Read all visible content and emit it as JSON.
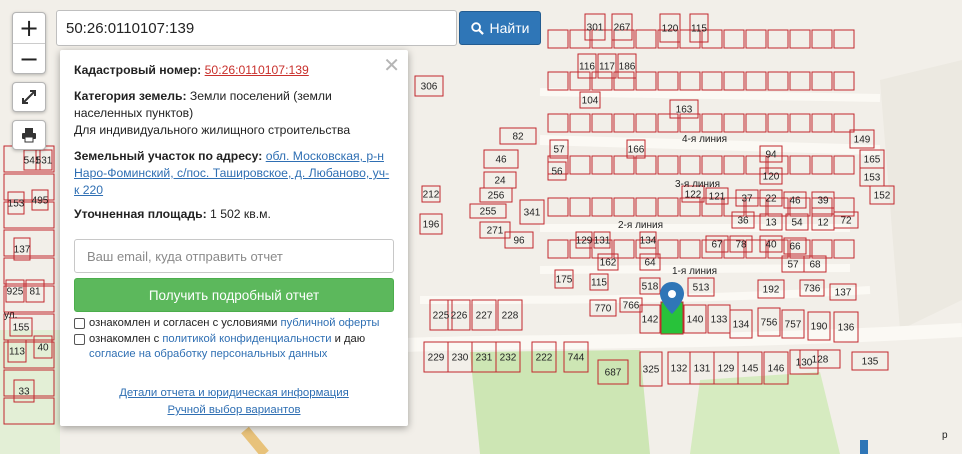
{
  "search": {
    "value": "50:26:0110107:139",
    "button_label": "Найти"
  },
  "zoom": {
    "in_label": "+",
    "out_label": "−"
  },
  "tools": {
    "fullscreen_icon": "fullscreen-icon",
    "print_icon": "printer-icon"
  },
  "popup": {
    "cadastral_label": "Кадастровый номер:",
    "cadastral_value": "50:26:0110107:139",
    "category_label": "Категория земель:",
    "category_value": "Земли поселений (земли населенных пунктов)",
    "usage": "Для индивидуального жилищного строительства",
    "address_label": "Земельный участок по адресу:",
    "address_value": "обл. Московская, р-н Наро-Фоминский, с/пос. Ташировское, д. Любаново, уч-к 220",
    "area_label": "Уточненная площадь:",
    "area_value": "1 502 кв.м.",
    "email_placeholder": "Ваш email, куда отправить отчет",
    "report_button": "Получить подробный отчет",
    "consent1_text": "ознакомлен и согласен с условиями ",
    "consent1_link": "публичной оферты",
    "consent2_text": "ознакомлен с ",
    "consent2_link": "политикой конфиденциальности",
    "consent2_tail": " и даю",
    "consent2_link2": "согласие на обработку персональных данных",
    "details_link": "Детали отчета и юридическая информация",
    "manual_link": "Ручной выбор вариантов"
  },
  "map": {
    "colors": {
      "parcel": "#c2272d",
      "selected": "#28c23a",
      "road": "#f7f4ee",
      "green": "#cde6b4",
      "marker": "#2f76b7"
    },
    "street_labels": [
      "4-я линия",
      "3-я линия",
      "2-я линия",
      "1-я линия",
      "ул.",
      "р"
    ],
    "parcel_numbers": [
      "301",
      "267",
      "120",
      "115",
      "116",
      "117",
      "186",
      "306",
      "104",
      "163",
      "82",
      "57",
      "166",
      "56",
      "46",
      "24",
      "256",
      "255",
      "271",
      "96",
      "341",
      "212",
      "196",
      "129",
      "131",
      "134",
      "162",
      "64",
      "175",
      "115",
      "518",
      "770",
      "766",
      "142",
      "140",
      "133",
      "134",
      "756",
      "757",
      "190",
      "136",
      "513",
      "192",
      "736",
      "137",
      "228",
      "227",
      "225",
      "226",
      "229",
      "230",
      "231",
      "232",
      "222",
      "744",
      "687",
      "325",
      "132",
      "131",
      "129",
      "145",
      "146",
      "130",
      "128",
      "135",
      "122",
      "121",
      "37",
      "22",
      "46",
      "39",
      "72",
      "36",
      "13",
      "54",
      "12",
      "67",
      "78",
      "40",
      "66",
      "68",
      "57",
      "120",
      "149",
      "165",
      "153",
      "152",
      "94",
      "541",
      "531",
      "495",
      "153",
      "137",
      "925",
      "81",
      "155",
      "40",
      "113",
      "33"
    ]
  }
}
